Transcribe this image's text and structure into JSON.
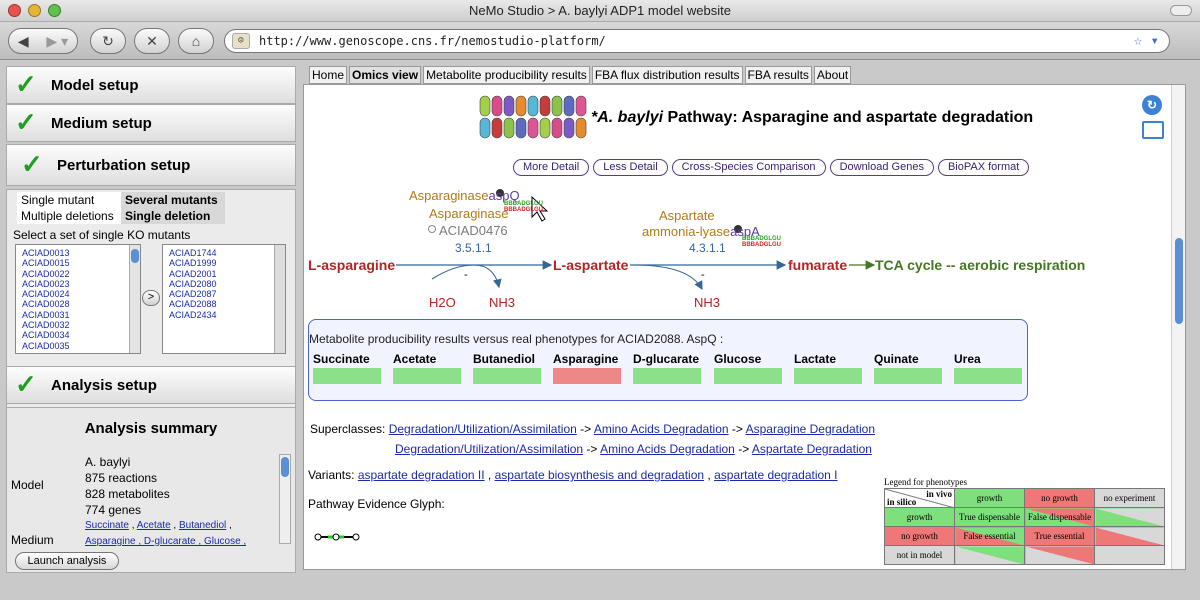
{
  "window": {
    "title": "NeMo Studio > A. baylyi ADP1 model website"
  },
  "browser": {
    "url": "http://www.genoscope.cns.fr/nemostudio-platform/"
  },
  "left": {
    "sections": [
      "Model setup",
      "Medium setup",
      "Perturbation setup"
    ],
    "analysis_setup": "Analysis setup",
    "pert": {
      "tab_single_mutant": "Single mutant",
      "tab_several_mutants": "Several mutants",
      "tab_multiple_deletions": "Multiple deletions",
      "tab_single_deletion": "Single deletion",
      "select_label": "Select a set of single KO mutants",
      "list_a": [
        "ACIAD0013",
        "ACIAD0015",
        "ACIAD0022",
        "ACIAD0023",
        "ACIAD0024",
        "ACIAD0028",
        "ACIAD0031",
        "ACIAD0032",
        "ACIAD0034",
        "ACIAD0035"
      ],
      "list_b": [
        "ACIAD1744",
        "ACIAD1999",
        "ACIAD2001",
        "ACIAD2080",
        "ACIAD2087",
        "ACIAD2088",
        "ACIAD2434"
      ],
      "move_label": ">"
    },
    "summary": {
      "title": "Analysis summary",
      "model_label": "Model",
      "model_name": "A. baylyi",
      "reactions": "875 reactions",
      "metabolites": "828 metabolites",
      "genes": "774 genes",
      "medium_label": "Medium",
      "medium_items": [
        "Succinate",
        "Acetate",
        "Butanediol"
      ],
      "medium_sep": " , ",
      "medium_trail": " ,",
      "medium_items2": "Asparagine , D-glucarate , Glucose ,",
      "launch": "Launch analysis"
    }
  },
  "tabs": [
    "Home",
    "Omics view",
    "Metabolite producibility results",
    "FBA flux distribution results",
    "FBA results",
    "About"
  ],
  "pathway": {
    "title_organism": "*A. baylyi",
    "title_rest": " Pathway: Asparagine and aspartate degradation",
    "buttons": [
      "More Detail",
      "Less Detail",
      "Cross-Species Comparison",
      "Download Genes",
      "BioPAX format"
    ],
    "enzyme1": {
      "name1": "Asparaginase",
      "gene1": "aspQ",
      "name2": "Asparaginase",
      "gene2": "ACIAD0476",
      "ec": "3.5.1.1"
    },
    "enzyme2": {
      "name1": "Aspartate",
      "name2": "ammonia-lyase",
      "gene": "aspA",
      "ec": "4.3.1.1"
    },
    "glyph_txt1": "BBBADGLGU",
    "glyph_txt2": "BBBADGLGU",
    "compounds": {
      "c1": "L-asparagine",
      "c2": "L-aspartate",
      "c3": "fumarate",
      "c4": "TCA cycle -- aerobic respiration",
      "h2o": "H2O",
      "nh3a": "NH3",
      "nh3b": "NH3",
      "minus": "-"
    },
    "result_title": "Metabolite producibility results versus real phenotypes for ACIAD2088. AspQ :",
    "metabolites": [
      {
        "name": "Succinate",
        "status": "growth"
      },
      {
        "name": "Acetate",
        "status": "growth"
      },
      {
        "name": "Butanediol",
        "status": "growth"
      },
      {
        "name": "Asparagine",
        "status": "no growth"
      },
      {
        "name": "D-glucarate",
        "status": "growth"
      },
      {
        "name": "Glucose",
        "status": "growth"
      },
      {
        "name": "Lactate",
        "status": "growth"
      },
      {
        "name": "Quinate",
        "status": "growth"
      },
      {
        "name": "Urea",
        "status": "growth"
      }
    ],
    "superclasses_label": "Superclasses:",
    "superclass_paths": [
      [
        "Degradation/Utilization/Assimilation",
        "Amino Acids Degradation",
        "Asparagine Degradation"
      ],
      [
        "Degradation/Utilization/Assimilation",
        "Amino Acids Degradation",
        "Aspartate Degradation"
      ]
    ],
    "arrow": " ->",
    "variants_label": "Variants:",
    "variants": [
      "aspartate degradation II",
      "aspartate biosynthesis and degradation",
      "aspartate degradation I"
    ],
    "evidence_label": "Pathway Evidence Glyph:"
  },
  "legend": {
    "title": "Legend for phenotypes",
    "in_vivo": "in vivo",
    "in_silico": "in silico",
    "cols": [
      "growth",
      "no growth",
      "no experiment"
    ],
    "rows": [
      [
        "growth",
        "True dispensable",
        "False dispensable",
        ""
      ],
      [
        "no growth",
        "False essential",
        "True essential",
        ""
      ],
      [
        "not in model",
        "",
        "",
        ""
      ]
    ],
    "colors": {
      "green": "#7ee07c",
      "red": "#ee7777",
      "grey": "#d8d8d8"
    }
  }
}
